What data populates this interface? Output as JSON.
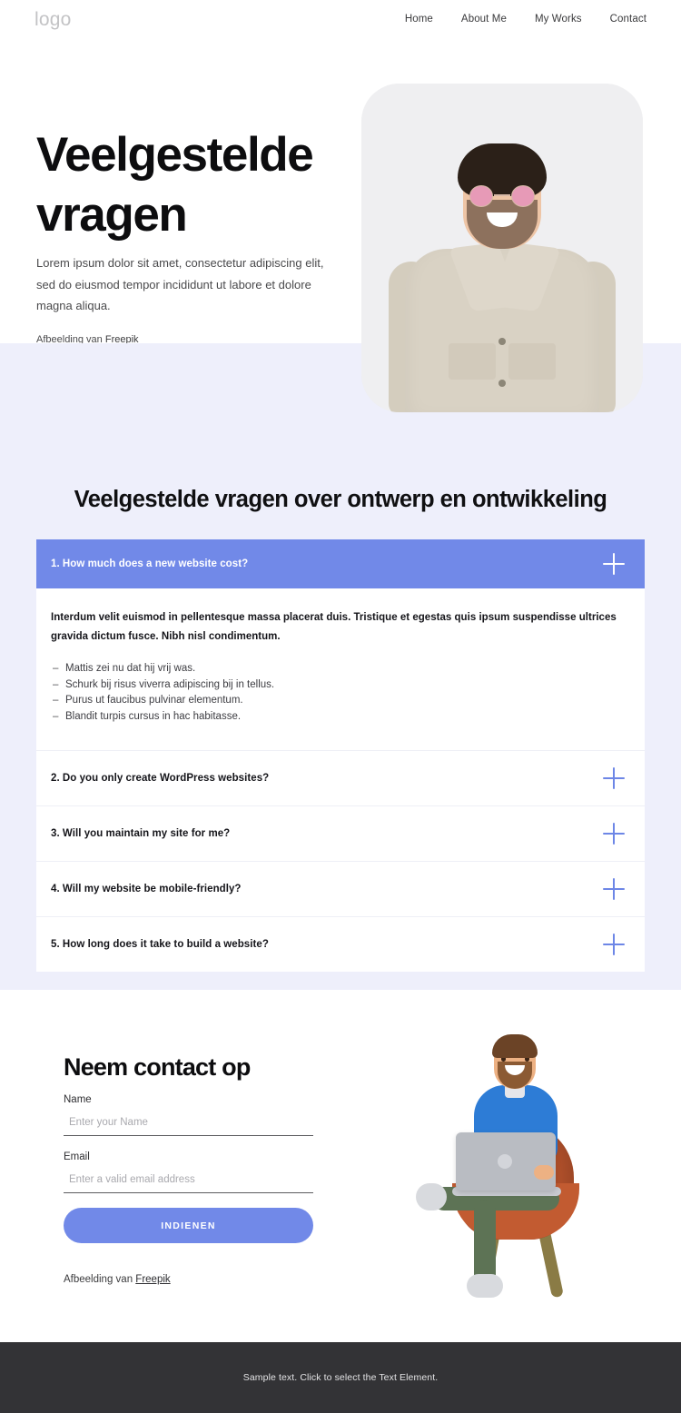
{
  "header": {
    "logo": "logo",
    "nav": [
      {
        "label": "Home"
      },
      {
        "label": "About Me"
      },
      {
        "label": "My Works"
      },
      {
        "label": "Contact"
      }
    ]
  },
  "hero": {
    "title": "Veelgestelde vragen",
    "subtitle": "Lorem ipsum dolor sit amet, consectetur adipiscing elit, sed do eiusmod tempor incididunt ut labore et dolore magna aliqua.",
    "credit_prefix": "Afbeelding van ",
    "credit_link": "Freepik",
    "image_alt": "smiling-man-in-beige-denim-jacket-with-pink-sunglasses"
  },
  "faq": {
    "heading": "Veelgestelde vragen over ontwerp en ontwikkeling",
    "items": [
      {
        "question": "1. How much does a new website cost?",
        "open": true,
        "icon": "plus-icon",
        "lead": "Interdum velit euismod in pellentesque massa placerat duis. Tristique et egestas quis ipsum suspendisse ultrices gravida dictum fusce. Nibh nisl condimentum.",
        "bullets": [
          "Mattis zei nu dat hij vrij was.",
          "Schurk bij risus viverra adipiscing bij in tellus.",
          "Purus ut faucibus pulvinar elementum.",
          "Blandit turpis cursus in hac habitasse."
        ]
      },
      {
        "question": "2. Do you only create WordPress websites?",
        "open": false,
        "icon": "plus-icon"
      },
      {
        "question": "3. Will you maintain my site for me?",
        "open": false,
        "icon": "plus-icon"
      },
      {
        "question": "4. Will my website be mobile-friendly?",
        "open": false,
        "icon": "plus-icon"
      },
      {
        "question": "5. How long does it take to build a website?",
        "open": false,
        "icon": "plus-icon"
      }
    ]
  },
  "contact": {
    "title": "Neem contact op",
    "name_label": "Name",
    "name_placeholder": "Enter your Name",
    "name_value": "",
    "email_label": "Email",
    "email_placeholder": "Enter a valid email address",
    "email_value": "",
    "submit_label": "INDIENEN",
    "credit_prefix": "Afbeelding van ",
    "credit_link": "Freepik",
    "illustration_alt": "3d-character-sitting-in-orange-armchair-with-laptop"
  },
  "footer": {
    "text": "Sample text. Click to select the Text Element."
  },
  "colors": {
    "accent": "#7189e8",
    "section_bg": "#eeeffb",
    "footer_bg": "#333336",
    "page_bg": "#ffffff",
    "text_dark": "#0d0d0f"
  }
}
